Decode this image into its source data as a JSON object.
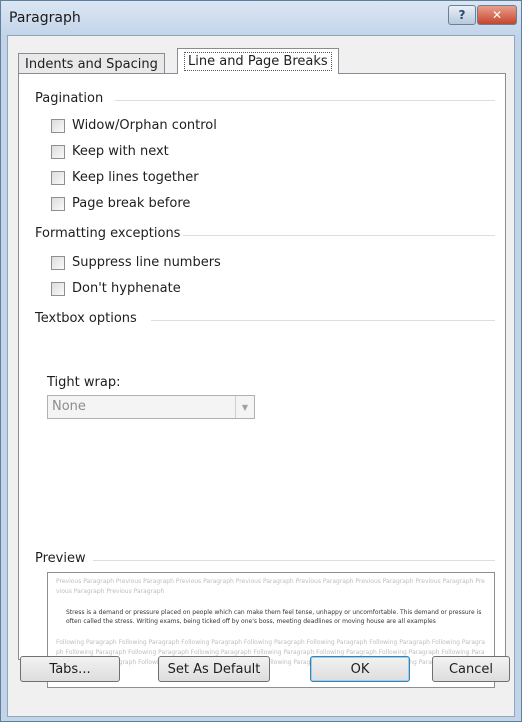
{
  "window": {
    "title": "Paragraph",
    "help_glyph": "?",
    "close_glyph": "✕"
  },
  "tabs": [
    {
      "label": "Indents and Spacing"
    },
    {
      "label": "Line and Page Breaks"
    }
  ],
  "pagination": {
    "label": "Pagination",
    "options": [
      {
        "label": "Widow/Orphan control"
      },
      {
        "label": "Keep with next"
      },
      {
        "label": "Keep lines together"
      },
      {
        "label": "Page break before"
      }
    ]
  },
  "formatting": {
    "label": "Formatting exceptions",
    "options": [
      {
        "label": "Suppress line numbers"
      },
      {
        "label": "Don't hyphenate"
      }
    ]
  },
  "textbox": {
    "label": "Textbox options",
    "tight_wrap_label": "Tight wrap:",
    "tight_wrap_value": "None",
    "dropdown_glyph": "▼"
  },
  "preview": {
    "label": "Preview",
    "previous": "Previous Paragraph Previous Paragraph Previous Paragraph Previous Paragraph Previous Paragraph Previous Paragraph Previous Paragraph Previous Paragraph Previous Paragraph",
    "current": "Stress is a demand or pressure placed on people which can make them feel tense, unhappy or uncomfortable. This demand or pressure is often called the stress. Writing exams, being ticked off by one's boss, meeting deadlines or moving house are all examples",
    "following": "Following Paragraph Following Paragraph Following Paragraph Following Paragraph Following Paragraph Following Paragraph Following Paragraph Following Paragraph Following Paragraph Following Paragraph Following Paragraph Following Paragraph Following Paragraph Following Paragraph Following Paragraph Following Paragraph Following Paragraph Following Paragraph Following Paragraph Following Paragraph"
  },
  "buttons": {
    "tabs": "Tabs...",
    "set_default": "Set As Default",
    "ok": "OK",
    "cancel": "Cancel"
  }
}
